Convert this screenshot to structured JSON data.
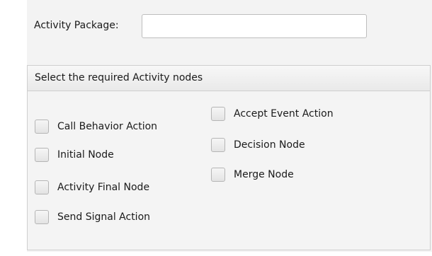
{
  "package": {
    "label": "Activity Package:",
    "value": "",
    "placeholder": ""
  },
  "nodes_group": {
    "title": "Select the required Activity nodes",
    "left_column": [
      {
        "label": "Call Behavior Action",
        "checked": false
      },
      {
        "label": "Initial Node",
        "checked": false
      },
      {
        "label": "Activity Final Node",
        "checked": false
      },
      {
        "label": "Send Signal Action",
        "checked": false
      }
    ],
    "right_column": [
      {
        "label": "Accept Event Action",
        "checked": false
      },
      {
        "label": "Decision Node",
        "checked": false
      },
      {
        "label": "Merge Node",
        "checked": false
      }
    ]
  }
}
